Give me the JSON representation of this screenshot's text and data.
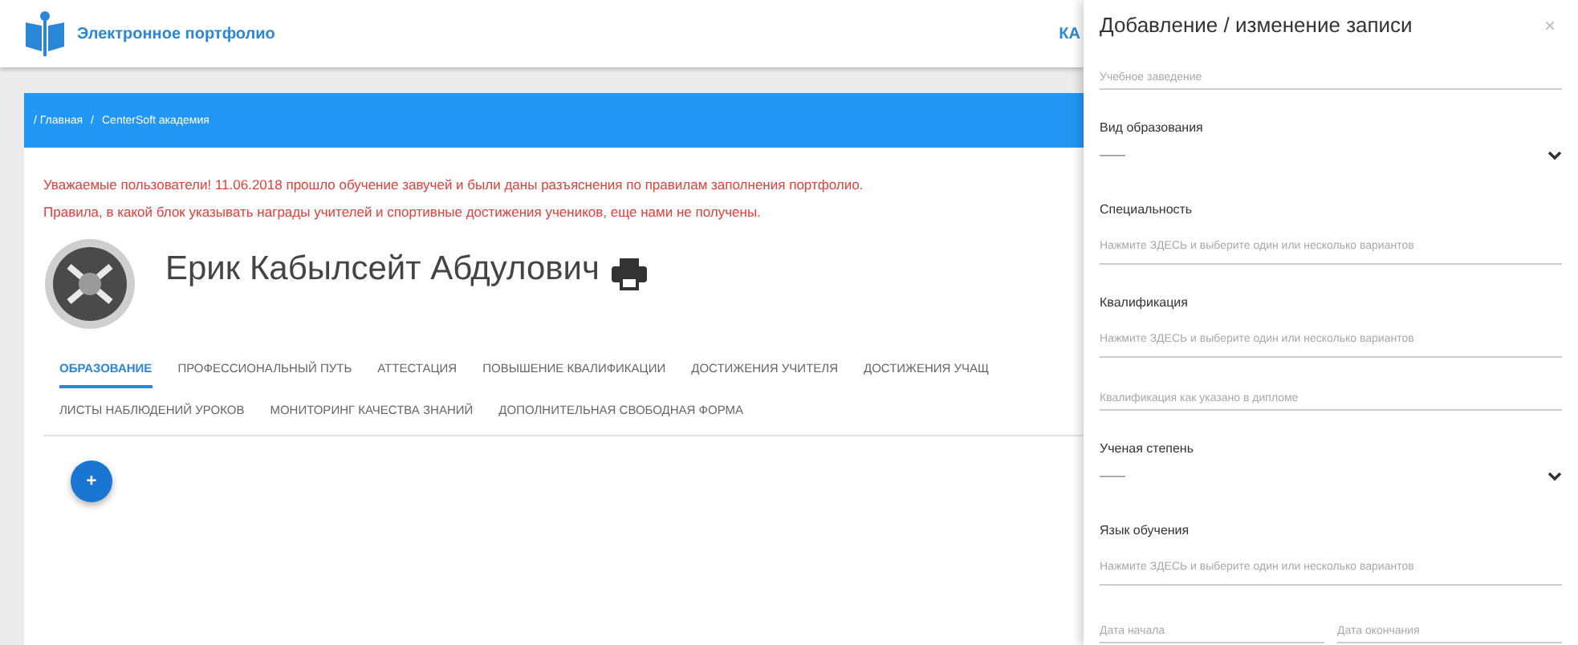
{
  "header": {
    "app_title": "Электронное портфолио",
    "nav_item": "КА"
  },
  "breadcrumbs": [
    "/ Главная",
    "/",
    "CenterSoft академия"
  ],
  "notices": [
    "Уважаемые пользователи! 11.06.2018 прошло обучение завучей и были даны разъяснения по правилам заполнения портфолио.",
    "Правила, в какой блок указывать награды учителей и спортивные достижения учеников, еще нами не получены."
  ],
  "profile": {
    "name": "Ерик Кабылсейт Абдулович"
  },
  "tabs": [
    {
      "label": "ОБРАЗОВАНИЕ",
      "selected": true
    },
    {
      "label": "ПРОФЕССИОНАЛЬНЫЙ ПУТЬ",
      "selected": false
    },
    {
      "label": "АТТЕСТАЦИЯ",
      "selected": false
    },
    {
      "label": "ПОВЫШЕНИЕ КВАЛИФИКАЦИИ",
      "selected": false
    },
    {
      "label": "ДОСТИЖЕНИЯ УЧИТЕЛЯ",
      "selected": false
    },
    {
      "label": "ДОСТИЖЕНИЯ УЧАЩ",
      "selected": false
    },
    {
      "label": "ЛИСТЫ НАБЛЮДЕНИЙ УРОКОВ",
      "selected": false
    },
    {
      "label": "МОНИТОРИНГ КАЧЕСТВА ЗНАНИЙ",
      "selected": false
    },
    {
      "label": "ДОПОЛНИТЕЛЬНАЯ СВОБОДНАЯ ФОРМА",
      "selected": false
    }
  ],
  "add_button": {
    "label": "+"
  },
  "drawer": {
    "title": "Добавление / изменение записи",
    "close": "×",
    "fields": [
      {
        "kind": "input",
        "placeholder": "Учебное заведение"
      },
      {
        "kind": "select",
        "label": "Вид образования",
        "value": "——"
      },
      {
        "kind": "multi",
        "label": "Специальность",
        "placeholder": "Нажмите ЗДЕСЬ и выберите один или несколько вариантов"
      },
      {
        "kind": "multi",
        "label": "Квалификация",
        "placeholder": "Нажмите ЗДЕСЬ и выберите один или несколько вариантов"
      },
      {
        "kind": "input",
        "placeholder": "Квалификация как указано в дипломе"
      },
      {
        "kind": "select",
        "label": "Ученая степень",
        "value": "——"
      },
      {
        "kind": "multi",
        "label": "Язык обучения",
        "placeholder": "Нажмите ЗДЕСЬ и выберите один или несколько вариантов"
      },
      {
        "kind": "pair",
        "placeholders": [
          "Дата начала",
          "Дата окончания"
        ]
      }
    ]
  }
}
